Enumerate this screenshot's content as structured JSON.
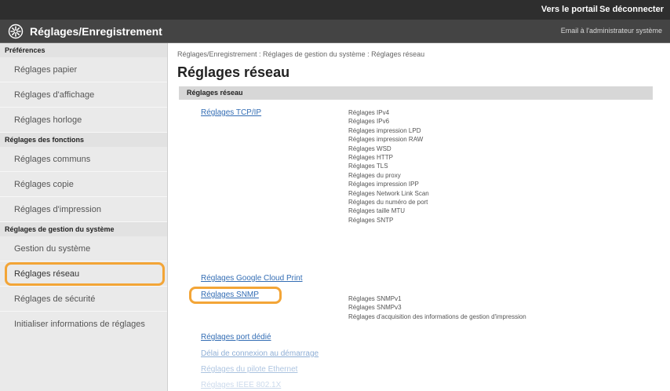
{
  "topbar": {
    "device": "",
    "portal_link": "Vers le portail",
    "logout_link": "Se déconnecter"
  },
  "header": {
    "title": "Réglages/Enregistrement",
    "mail_link": "Email à l'administrateur système"
  },
  "sidebar": {
    "preferences": {
      "title": "Préférences",
      "items": [
        "Réglages papier",
        "Réglages d'affichage",
        "Réglages horloge"
      ]
    },
    "functions": {
      "title": "Réglages des fonctions",
      "items": [
        "Réglages communs",
        "Réglages copie",
        "Réglages d'impression"
      ]
    },
    "system": {
      "title": "Réglages de gestion du système",
      "items": [
        "Gestion du système",
        "Réglages réseau",
        "Réglages de sécurité",
        "Initialiser informations de réglages"
      ]
    }
  },
  "main": {
    "breadcrumb": "Réglages/Enregistrement : Réglages de gestion du système : Réglages réseau",
    "title": "Réglages réseau",
    "section_title": "Réglages réseau",
    "links": {
      "tcpip": "Réglages TCP/IP",
      "google": "Réglages Google Cloud Print",
      "snmp": "Réglages SNMP",
      "port": "Réglages port dédié",
      "delay": "Délai de connexion au démarrage",
      "ethernet": "Réglages du pilote Ethernet",
      "ieee": "Réglages IEEE 802.1X"
    },
    "tcpip_subitems": [
      "Réglages IPv4",
      "Réglages IPv6",
      "Réglages impression LPD",
      "Réglages impression RAW",
      "Réglages WSD",
      "Réglages HTTP",
      "Réglages TLS",
      "Réglages du proxy",
      "Réglages impression IPP",
      "Réglages Network Link Scan",
      "Réglages du numéro de port",
      "Réglages taille MTU",
      "Réglages SNTP"
    ],
    "snmp_subitems": [
      "Réglages SNMPv1",
      "Réglages SNMPv3",
      "Réglages d'acquisition des informations de gestion d'impression"
    ]
  },
  "colors": {
    "highlight": "#f3a537",
    "link": "#336db4",
    "header_bg": "#444444"
  }
}
